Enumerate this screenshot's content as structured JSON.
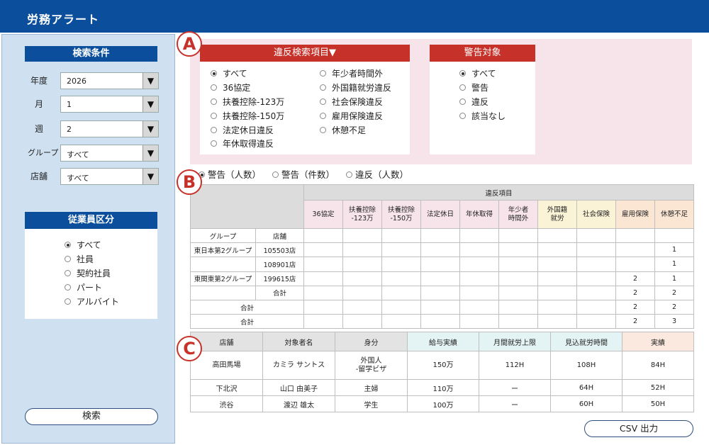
{
  "app": {
    "title": "労務アラート"
  },
  "sidebar": {
    "search_header": "検索条件",
    "filters": {
      "year": {
        "label": "年度",
        "value": "2026"
      },
      "month": {
        "label": "月",
        "value": "1"
      },
      "week": {
        "label": "週",
        "value": "2"
      },
      "group": {
        "label": "グループ",
        "value": "すべて"
      },
      "store": {
        "label": "店舗",
        "value": "すべて"
      }
    },
    "employee_header": "従業員区分",
    "employee_types": [
      {
        "label": "すべて",
        "selected": true
      },
      {
        "label": "社員",
        "selected": false
      },
      {
        "label": "契約社員",
        "selected": false
      },
      {
        "label": "パート",
        "selected": false
      },
      {
        "label": "アルバイト",
        "selected": false
      }
    ],
    "search_button": "検索"
  },
  "markers": {
    "a": "A",
    "b": "B",
    "c": "C"
  },
  "violation_search": {
    "header": "違反検索項目▼",
    "options": [
      {
        "label": "すべて",
        "selected": true
      },
      {
        "label": "36協定",
        "selected": false
      },
      {
        "label": "扶養控除-123万",
        "selected": false
      },
      {
        "label": "扶養控除-150万",
        "selected": false
      },
      {
        "label": "法定休日違反",
        "selected": false
      },
      {
        "label": "年休取得違反",
        "selected": false
      },
      {
        "label": "年少者時間外",
        "selected": false
      },
      {
        "label": "外国籍就労違反",
        "selected": false
      },
      {
        "label": "社会保険違反",
        "selected": false
      },
      {
        "label": "雇用保険違反",
        "selected": false
      },
      {
        "label": "休憩不足",
        "selected": false
      }
    ]
  },
  "warning_target": {
    "header": "警告対象",
    "options": [
      {
        "label": "すべて",
        "selected": true
      },
      {
        "label": "警告",
        "selected": false
      },
      {
        "label": "違反",
        "selected": false
      },
      {
        "label": "該当なし",
        "selected": false
      }
    ]
  },
  "count_modes": [
    {
      "label": "警告（人数）",
      "selected": true
    },
    {
      "label": "警告（件数）",
      "selected": false
    },
    {
      "label": "違反（人数）",
      "selected": false
    }
  ],
  "summary_table": {
    "group_header": "違反項目",
    "columns": [
      "36協定",
      "扶養控除\n-123万",
      "扶養控除\n-150万",
      "法定休日",
      "年休取得",
      "年少者\n時間外",
      "外国籍\n就労",
      "社会保険",
      "雇用保険",
      "休憩不足"
    ],
    "row_headers": {
      "group": "グループ",
      "store": "店舗"
    },
    "rows": [
      {
        "group": "東日本第2グループ",
        "store": "105503店",
        "values": [
          "",
          "",
          "",
          "",
          "",
          "",
          "",
          "",
          "",
          "1"
        ]
      },
      {
        "group": "",
        "store": "108901店",
        "values": [
          "",
          "",
          "",
          "",
          "",
          "",
          "",
          "",
          "",
          "1"
        ]
      },
      {
        "group": "東関東第2グループ",
        "store": "199615店",
        "values": [
          "",
          "",
          "",
          "",
          "",
          "",
          "",
          "",
          "2",
          "1"
        ]
      },
      {
        "group": "",
        "store": "合計",
        "values": [
          "",
          "",
          "",
          "",
          "",
          "",
          "",
          "",
          "2",
          "2"
        ]
      }
    ],
    "totals": [
      {
        "label": "合計",
        "values": [
          "",
          "",
          "",
          "",
          "",
          "",
          "",
          "",
          "2",
          "2"
        ]
      },
      {
        "label": "合計",
        "values": [
          "",
          "",
          "",
          "",
          "",
          "",
          "",
          "",
          "2",
          "3"
        ]
      }
    ]
  },
  "detail_table": {
    "headers": [
      "店舗",
      "対象者名",
      "身分",
      "給与実績",
      "月間就労上限",
      "見込就労時間",
      "実績"
    ],
    "rows": [
      [
        "高田馬場",
        "カミラ サントス",
        "外国人\n-留学ビザ",
        "150万",
        "112H",
        "108H",
        "84H"
      ],
      [
        "下北沢",
        "山口 由美子",
        "主婦",
        "110万",
        "ー",
        "64H",
        "52H"
      ],
      [
        "渋谷",
        "渡辺 雄太",
        "学生",
        "100万",
        "ー",
        "60H",
        "50H"
      ]
    ]
  },
  "csv_button": "CSV 出力"
}
